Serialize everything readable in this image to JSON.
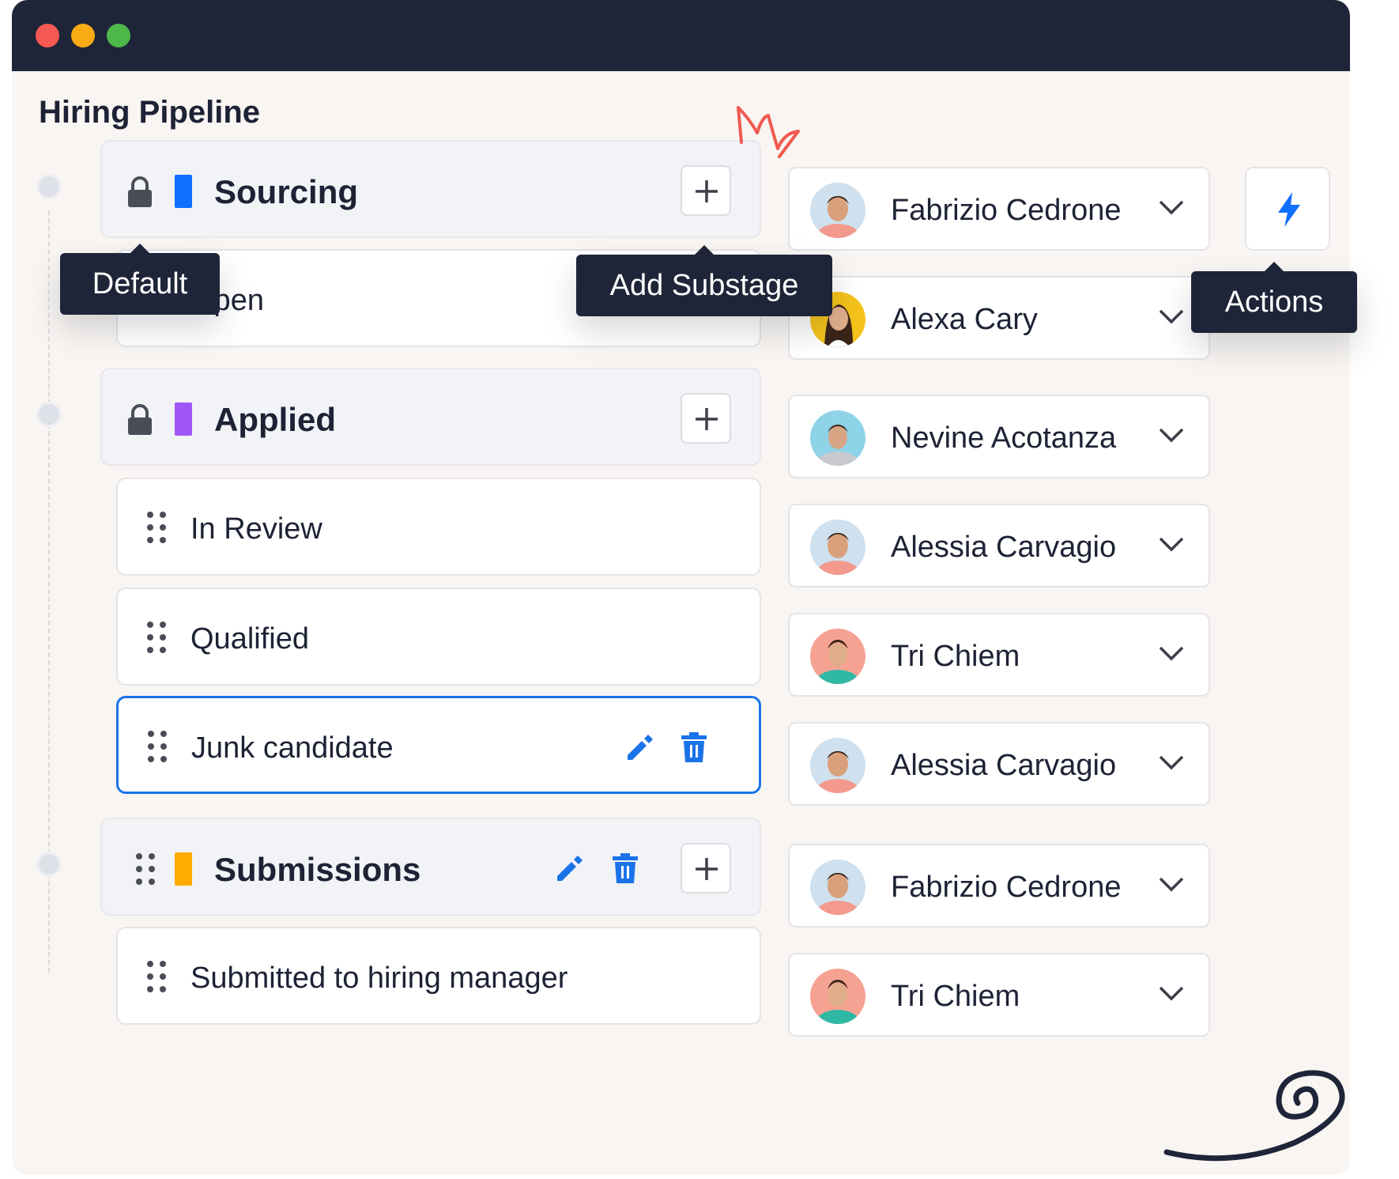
{
  "page": {
    "title": "Hiring Pipeline"
  },
  "colors": {
    "sourcing": "#0f6fff",
    "applied": "#a056f7",
    "submissions": "#ffab00",
    "accent_blue": "#1a73e8",
    "window_bar": "#1f2538"
  },
  "stages": [
    {
      "name": "Sourcing",
      "substages": [
        {
          "name": "Open",
          "assignee": "Alexa Cary"
        }
      ],
      "assignee": "Fabrizio Cedrone"
    },
    {
      "name": "Applied",
      "substages": [
        {
          "name": "In Review",
          "assignee": "Alessia Carvagio"
        },
        {
          "name": "Qualified",
          "assignee": "Tri Chiem"
        },
        {
          "name": "Junk candidate",
          "assignee": "Alessia Carvagio"
        }
      ],
      "assignee": "Nevine Acotanza"
    },
    {
      "name": "Submissions",
      "substages": [
        {
          "name": "Submitted to hiring manager",
          "assignee": "Tri Chiem"
        }
      ],
      "assignee": "Fabrizio Cedrone"
    }
  ],
  "tooltips": {
    "default": "Default",
    "add_substage": "Add Substage",
    "actions": "Actions"
  },
  "icons": [
    "lock-icon",
    "drag-handle-icon",
    "plus-icon",
    "edit-icon",
    "trash-icon",
    "chevron-down-icon",
    "lightning-icon"
  ]
}
